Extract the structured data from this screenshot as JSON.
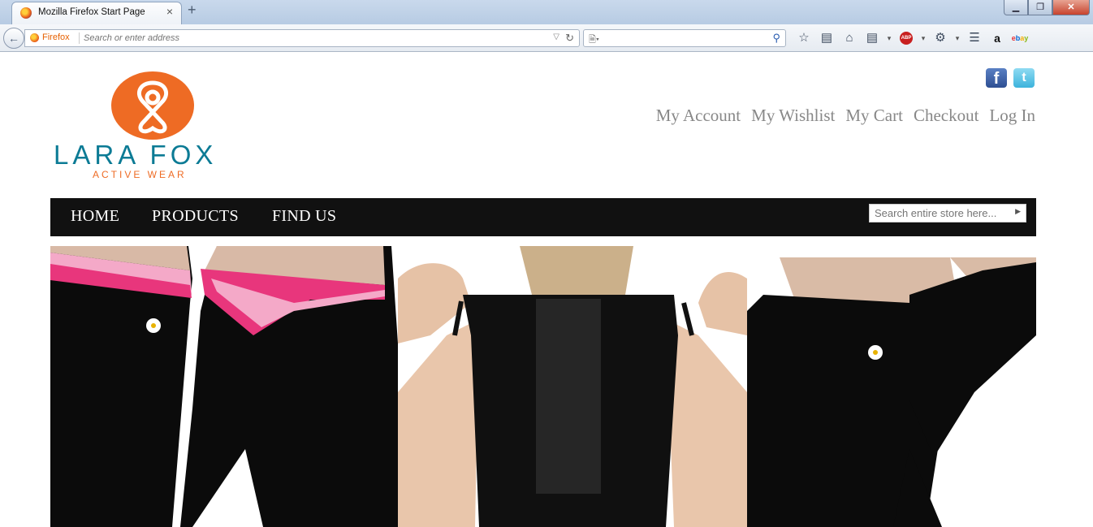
{
  "browser": {
    "tab_title": "Mozilla Firefox Start Page",
    "tab_close": "×",
    "new_tab": "+",
    "identity_label": "Firefox",
    "url_placeholder": "Search or enter address",
    "window_controls": {
      "minimize": "▁",
      "maximize": "❐",
      "close": "✕"
    },
    "toolbar_icons": [
      "back-arrow-icon",
      "reload-icon",
      "bookmark-star-icon",
      "reading-list-icon",
      "home-icon",
      "pocket-icon",
      "adblock-plus-icon",
      "extension-icon",
      "menu-icon",
      "amazon-icon",
      "ebay-icon"
    ]
  },
  "site": {
    "logo": {
      "brand": "LARA FOX",
      "tagline": "ACTIVE WEAR"
    },
    "social": {
      "facebook": "f",
      "twitter": "t"
    },
    "account_links": [
      "My Account",
      "My Wishlist",
      "My Cart",
      "Checkout",
      "Log In"
    ],
    "nav": [
      "HOME",
      "PRODUCTS",
      "FIND US"
    ],
    "search_placeholder": "Search entire store here...",
    "colors": {
      "brand_orange": "#ee6b24",
      "brand_teal": "#0c7b95",
      "nav_bg": "#111111",
      "link_gray": "#888888"
    }
  }
}
